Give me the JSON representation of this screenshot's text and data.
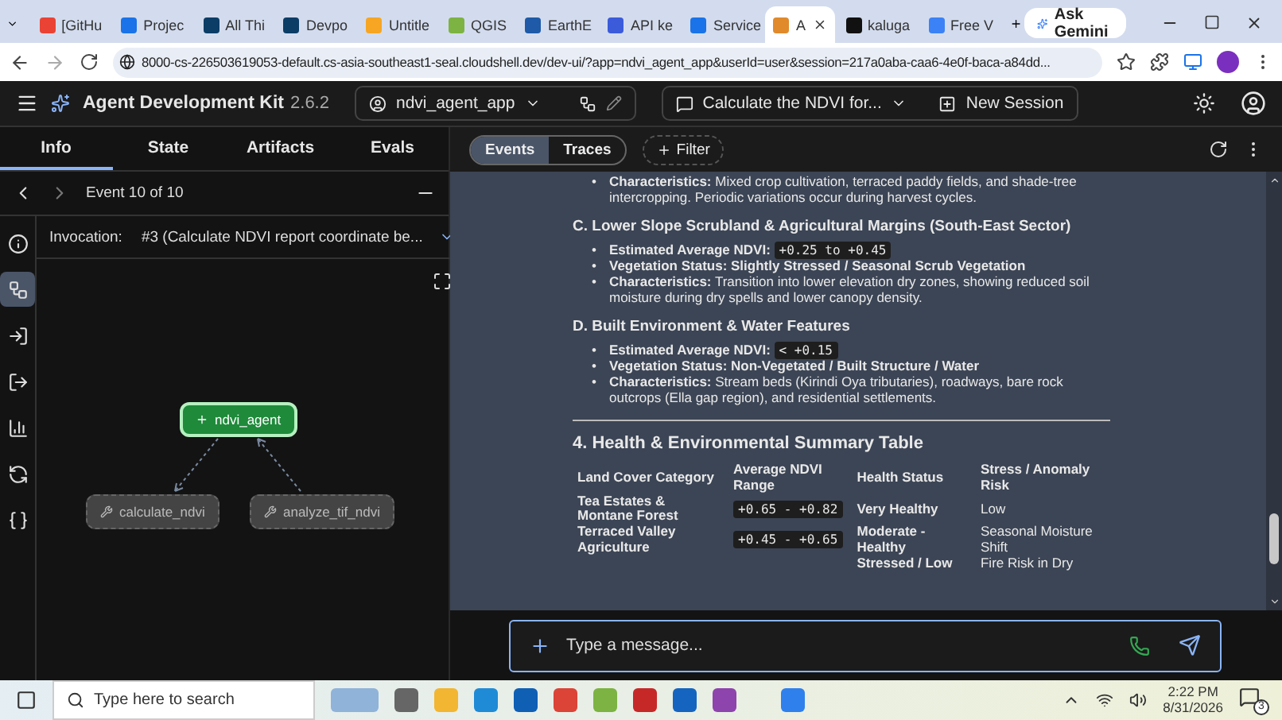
{
  "browser": {
    "tabs": [
      {
        "label": "[GitHu",
        "selected": false
      },
      {
        "label": "Projec",
        "selected": false
      },
      {
        "label": "All Thi",
        "selected": false
      },
      {
        "label": "Devpo",
        "selected": false
      },
      {
        "label": "Untitle",
        "selected": false
      },
      {
        "label": "QGIS",
        "selected": false
      },
      {
        "label": "EarthE",
        "selected": false
      },
      {
        "label": "API ke",
        "selected": false
      },
      {
        "label": "Service",
        "selected": false
      },
      {
        "label": "A",
        "selected": true
      },
      {
        "label": "kaluga",
        "selected": false
      },
      {
        "label": "Free V",
        "selected": false
      }
    ],
    "ask_gemini": "Ask Gemini",
    "url": "8000-cs-226503619053-default.cs-asia-southeast1-seal.cloudshell.dev/dev-ui/?app=ndvi_agent_app&userId=user&session=217a0aba-caa6-4e0f-baca-a84dd..."
  },
  "header": {
    "title": "Agent Development Kit",
    "version": "2.6.2",
    "app": "ndvi_agent_app",
    "session": "Calculate the NDVI for...",
    "new_session": "New Session"
  },
  "left": {
    "tabs": [
      {
        "label": "Info",
        "selected": true
      },
      {
        "label": "State",
        "selected": false
      },
      {
        "label": "Artifacts",
        "selected": false
      },
      {
        "label": "Evals",
        "selected": false
      }
    ],
    "event_nav": "Event 10 of 10",
    "rail": [
      {
        "kind": "info",
        "selected": false
      },
      {
        "kind": "graph",
        "selected": true
      },
      {
        "kind": "input",
        "selected": false
      },
      {
        "kind": "output",
        "selected": false
      },
      {
        "kind": "chart",
        "selected": false
      },
      {
        "kind": "check",
        "selected": false
      },
      {
        "kind": "code",
        "selected": false
      }
    ],
    "invocation_label": "Invocation:",
    "invocation": "#3 (Calculate NDVI report coordinate be...",
    "graph": {
      "root": "ndvi_agent",
      "tools": [
        "calculate_ndvi",
        "analyze_tif_ndvi"
      ]
    }
  },
  "right": {
    "view_tabs": [
      {
        "label": "Events",
        "selected": true
      },
      {
        "label": "Traces",
        "selected": false
      }
    ],
    "filter": "Filter",
    "content": [
      {
        "kind": "list",
        "marker": "•",
        "items": [
          {
            "label": "Characteristics:",
            "text": "Mixed crop cultivation, terraced paddy fields, and shade-tree intercropping. Periodic variations occur during harvest cycles."
          }
        ]
      },
      {
        "kind": "heading",
        "text": "C. Lower Slope Scrubland & Agricultural Margins (South-East Sector)"
      },
      {
        "kind": "list",
        "marker": "•",
        "items": [
          {
            "label": "Estimated Average NDVI:",
            "code": "+0.25 to +0.45"
          },
          {
            "label": "Vegetation Status: Slightly Stressed / Seasonal Scrub Vegetation"
          },
          {
            "label": "Characteristics:",
            "text": "Transition into lower elevation dry zones, showing reduced soil moisture during dry spells and lower canopy density."
          }
        ]
      },
      {
        "kind": "heading",
        "text": "D. Built Environment & Water Features"
      },
      {
        "kind": "list",
        "marker": "•",
        "items": [
          {
            "label": "Estimated Average NDVI:",
            "code": "< +0.15"
          },
          {
            "label": "Vegetation Status: Non-Vegetated / Built Structure / Water"
          },
          {
            "label": "Characteristics:",
            "text": "Stream beds (Kirindi Oya tributaries), roadways, bare rock outcrops (Ella gap region), and residential settlements."
          }
        ]
      },
      {
        "kind": "rule"
      },
      {
        "kind": "title",
        "text": "4. Health & Environmental Summary Table"
      },
      {
        "kind": "table",
        "columns": [
          "Land Cover Category",
          "Average NDVI Range",
          "Health Status",
          "Stress / Anomaly Risk"
        ],
        "rows": [
          {
            "category": "Tea Estates & Montane Forest",
            "range": "+0.65 - +0.82",
            "health": "Very Healthy",
            "risk": "Low"
          },
          {
            "category": "Terraced Valley Agriculture",
            "range": "+0.45 - +0.65",
            "health": "Moderate - Healthy",
            "risk": "Seasonal Moisture Shift"
          },
          {
            "health": "Stressed / Low",
            "risk": "Fire Risk in Dry"
          }
        ]
      }
    ],
    "input_placeholder": "Type a message..."
  },
  "taskbar": {
    "search": "Type here to search",
    "time": "2:22 PM",
    "date": "8/31/2026",
    "notifications": "3"
  }
}
